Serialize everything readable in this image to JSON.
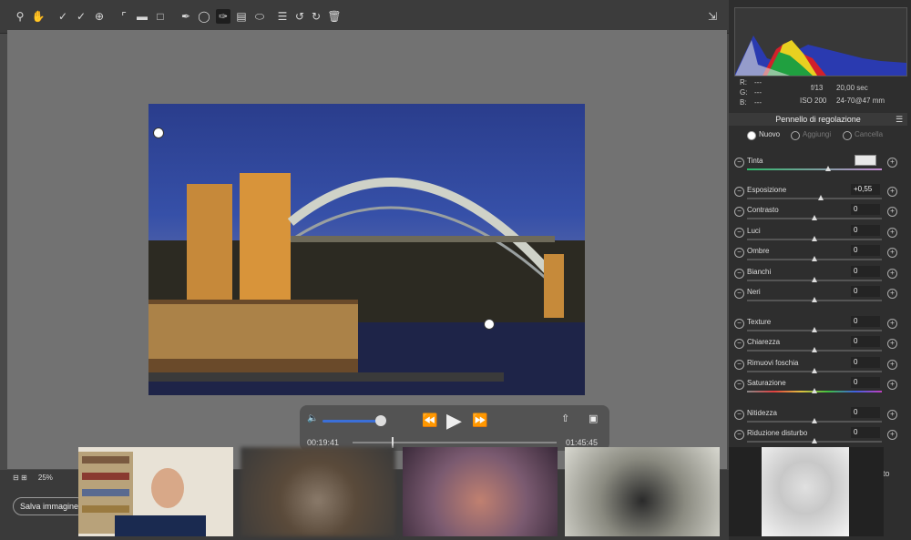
{
  "colors": {
    "accent": "#3b6fd8",
    "panel": "#2e2e2e",
    "canvas": "#727272"
  },
  "toolbar": {
    "icons": [
      "zoom-icon",
      "hand-icon",
      "eyedropper-icon",
      "color-sampler-icon",
      "target-adjust-icon",
      "crop-icon",
      "straighten-icon",
      "transform-icon",
      "spot-removal-icon",
      "red-eye-icon",
      "adjustment-brush-icon",
      "graduated-filter-icon",
      "radial-filter-icon",
      "list-icon",
      "rotate-left-icon",
      "rotate-right-icon",
      "trash-icon"
    ],
    "fullscreen_icon": "fullscreen-icon"
  },
  "info": {
    "r": "R:",
    "g": "G:",
    "b": "B:",
    "dash": "---",
    "aperture": "f/13",
    "shutter": "20,00 sec",
    "iso": "ISO 200",
    "lens": "24-70@47 mm"
  },
  "panel": {
    "title": "Pennello di regolazione",
    "modes": [
      "Nuovo",
      "Aggiungi",
      "Cancella"
    ],
    "sliders": [
      {
        "label": "Tinta",
        "value": "",
        "pos": 0.6
      },
      {
        "label": "Esposizione",
        "value": "+0,55",
        "pos": 0.55
      },
      {
        "label": "Contrasto",
        "value": "0",
        "pos": 0.5
      },
      {
        "label": "Luci",
        "value": "0",
        "pos": 0.5
      },
      {
        "label": "Ombre",
        "value": "0",
        "pos": 0.5
      },
      {
        "label": "Bianchi",
        "value": "0",
        "pos": 0.5
      },
      {
        "label": "Neri",
        "value": "0",
        "pos": 0.5
      },
      {
        "label": "Texture",
        "value": "0",
        "pos": 0.5
      },
      {
        "label": "Chiarezza",
        "value": "0",
        "pos": 0.5
      },
      {
        "label": "Rimuovi foschia",
        "value": "0",
        "pos": 0.5
      },
      {
        "label": "Saturazione",
        "value": "0",
        "pos": 0.5
      },
      {
        "label": "Nitidezza",
        "value": "0",
        "pos": 0.5
      },
      {
        "label": "Riduzione disturbo",
        "value": "0",
        "pos": 0.5
      }
    ]
  },
  "bottom": {
    "zoom": "25%",
    "save": "Salva immagine",
    "right_btn": "to"
  },
  "video": {
    "elapsed": "00:19:41",
    "remaining": "01:45:45",
    "volume": 0.85,
    "progress": 0.19
  }
}
